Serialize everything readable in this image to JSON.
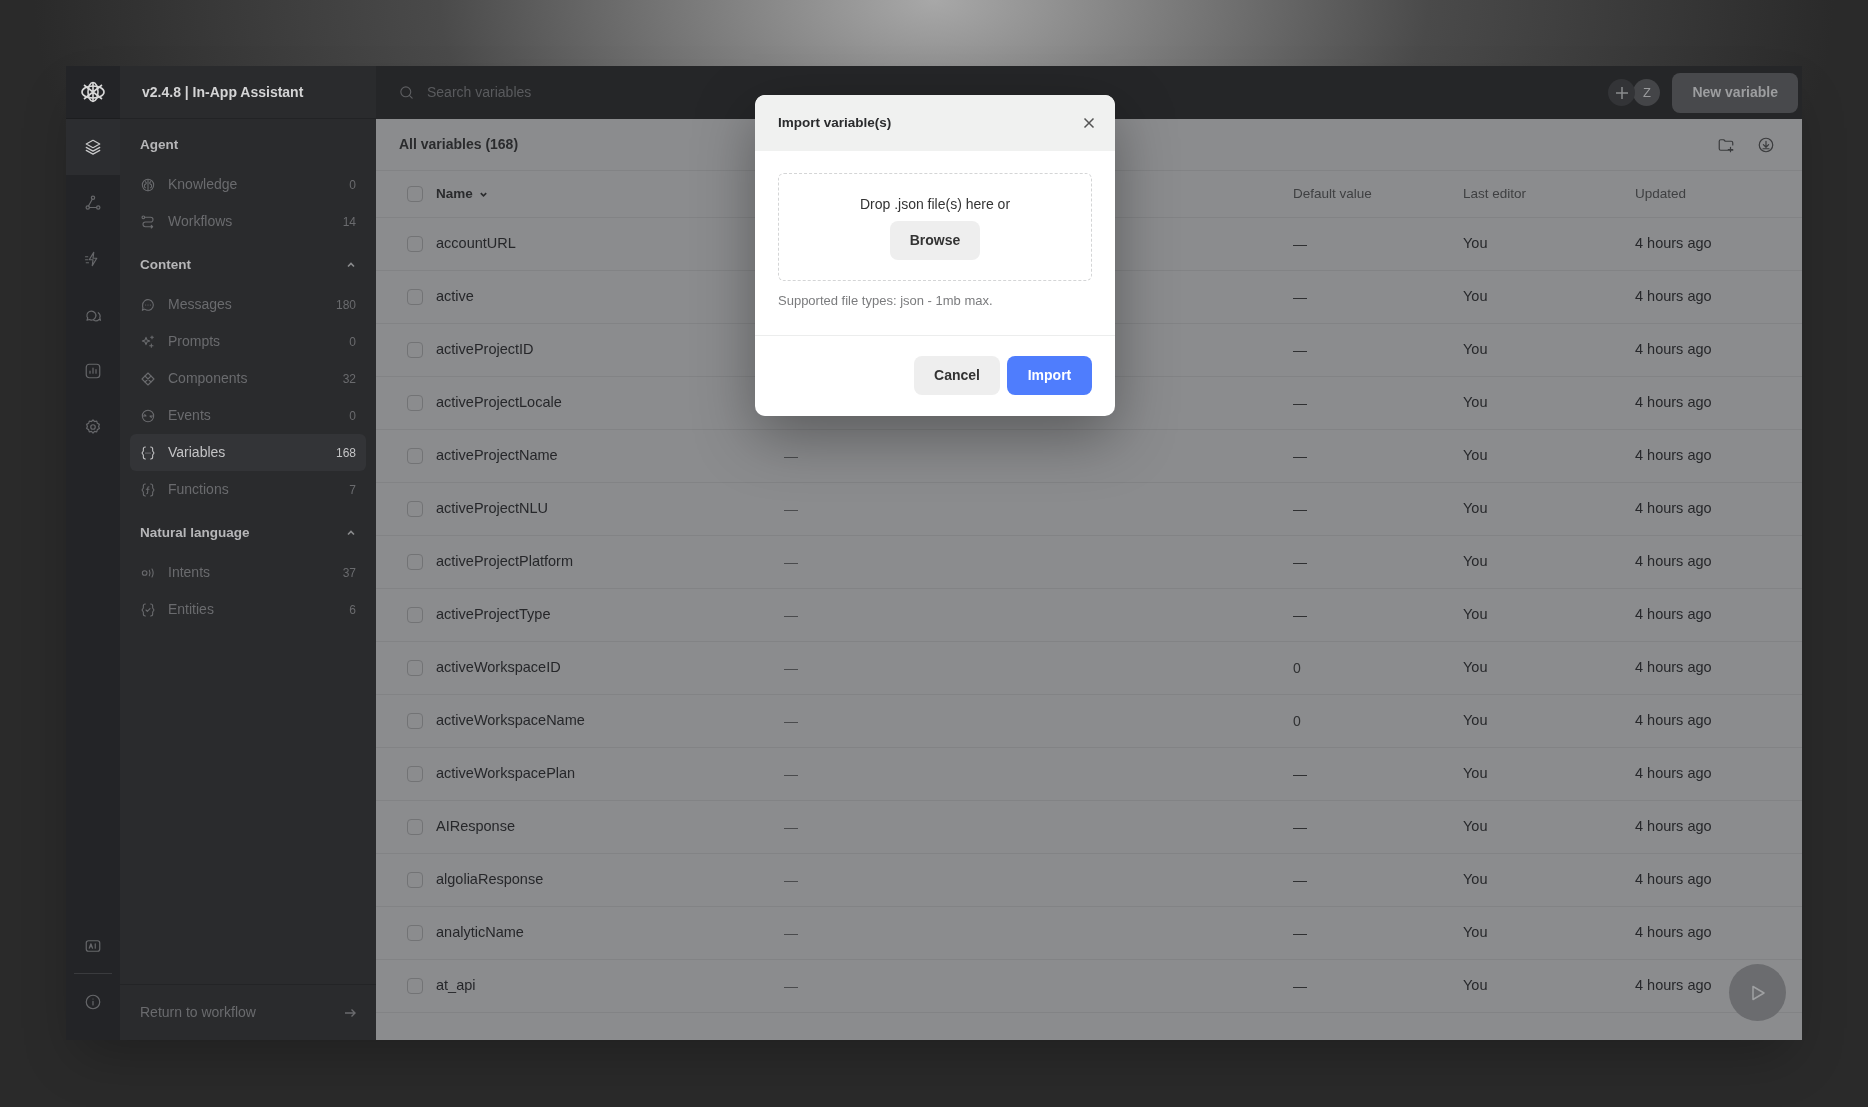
{
  "app": {
    "title": "v2.4.8 | In-App Assistant"
  },
  "rail": [
    {
      "kind": "layers",
      "selected": true
    },
    {
      "kind": "workflow",
      "selected": false
    },
    {
      "kind": "bolt",
      "selected": false
    },
    {
      "kind": "chat",
      "selected": false
    },
    {
      "kind": "chart",
      "selected": false
    },
    {
      "kind": "settings",
      "selected": false
    }
  ],
  "rail_bottom": [
    {
      "kind": "ai"
    },
    {
      "kind": "info"
    }
  ],
  "nav": {
    "sections": [
      {
        "title": "Agent",
        "items": [
          {
            "kind": "brain",
            "label": "Knowledge",
            "count": "0",
            "selected": false
          },
          {
            "kind": "route",
            "label": "Workflows",
            "count": "14",
            "selected": false
          }
        ]
      },
      {
        "title": "Content",
        "expanded": true,
        "items": [
          {
            "kind": "message",
            "label": "Messages",
            "count": "180",
            "selected": false
          },
          {
            "kind": "sparkles",
            "label": "Prompts",
            "count": "0",
            "selected": false
          },
          {
            "kind": "component",
            "label": "Components",
            "count": "32",
            "selected": false
          },
          {
            "kind": "event",
            "label": "Events",
            "count": "0",
            "selected": false
          },
          {
            "kind": "variable",
            "label": "Variables",
            "count": "168",
            "selected": true
          },
          {
            "kind": "function",
            "label": "Functions",
            "count": "7",
            "selected": false
          }
        ]
      },
      {
        "title": "Natural language",
        "expanded": true,
        "items": [
          {
            "kind": "intent",
            "label": "Intents",
            "count": "37",
            "selected": false
          },
          {
            "kind": "entity",
            "label": "Entities",
            "count": "6",
            "selected": false
          }
        ]
      }
    ],
    "return_link": "Return to workflow"
  },
  "search": {
    "placeholder": "Search variables"
  },
  "header": {
    "avatar": "Z",
    "new_button": "New variable"
  },
  "table": {
    "title": "All variables (168)",
    "select_all_checked": false,
    "columns": [
      {
        "label": "Name",
        "sorted": true
      },
      {
        "label": "Default value",
        "sorted": false
      },
      {
        "label": "Last editor",
        "sorted": false
      },
      {
        "label": "Updated",
        "sorted": false
      }
    ],
    "rows": [
      {
        "checked": false,
        "name": "accountURL",
        "default_value": "—",
        "last_editor": "You",
        "updated": "4 hours ago"
      },
      {
        "checked": false,
        "name": "active",
        "default_value": "—",
        "last_editor": "You",
        "updated": "4 hours ago"
      },
      {
        "checked": false,
        "name": "activeProjectID",
        "default_value": "—",
        "last_editor": "You",
        "updated": "4 hours ago"
      },
      {
        "checked": false,
        "name": "activeProjectLocale",
        "default_value": "—",
        "last_editor": "You",
        "updated": "4 hours ago"
      },
      {
        "checked": false,
        "name": "activeProjectName",
        "column_2": "—",
        "default_value": "—",
        "last_editor": "You",
        "updated": "4 hours ago"
      },
      {
        "checked": false,
        "name": "activeProjectNLU",
        "column_2": "—",
        "default_value": "—",
        "last_editor": "You",
        "updated": "4 hours ago"
      },
      {
        "checked": false,
        "name": "activeProjectPlatform",
        "column_2": "—",
        "default_value": "—",
        "last_editor": "You",
        "updated": "4 hours ago"
      },
      {
        "checked": false,
        "name": "activeProjectType",
        "column_2": "—",
        "default_value": "—",
        "last_editor": "You",
        "updated": "4 hours ago"
      },
      {
        "checked": false,
        "name": "activeWorkspaceID",
        "column_2": "—",
        "default_value": "0",
        "last_editor": "You",
        "updated": "4 hours ago"
      },
      {
        "checked": false,
        "name": "activeWorkspaceName",
        "column_2": "—",
        "default_value": "0",
        "last_editor": "You",
        "updated": "4 hours ago"
      },
      {
        "checked": false,
        "name": "activeWorkspacePlan",
        "column_2": "—",
        "default_value": "—",
        "last_editor": "You",
        "updated": "4 hours ago"
      },
      {
        "checked": false,
        "name": "AIResponse",
        "column_2": "—",
        "default_value": "—",
        "last_editor": "You",
        "updated": "4 hours ago"
      },
      {
        "checked": false,
        "name": "algoliaResponse",
        "column_2": "—",
        "default_value": "—",
        "last_editor": "You",
        "updated": "4 hours ago"
      },
      {
        "checked": false,
        "name": "analyticName",
        "column_2": "—",
        "default_value": "—",
        "last_editor": "You",
        "updated": "4 hours ago"
      },
      {
        "checked": false,
        "name": "at_api",
        "column_2": "—",
        "default_value": "—",
        "last_editor": "You",
        "updated": "4 hours ago"
      }
    ]
  },
  "modal": {
    "title": "Import variable(s)",
    "drop_text": "Drop .json file(s) here or",
    "browse": "Browse",
    "hint": "Supported file types: json - 1mb max.",
    "cancel": "Cancel",
    "confirm": "Import"
  }
}
